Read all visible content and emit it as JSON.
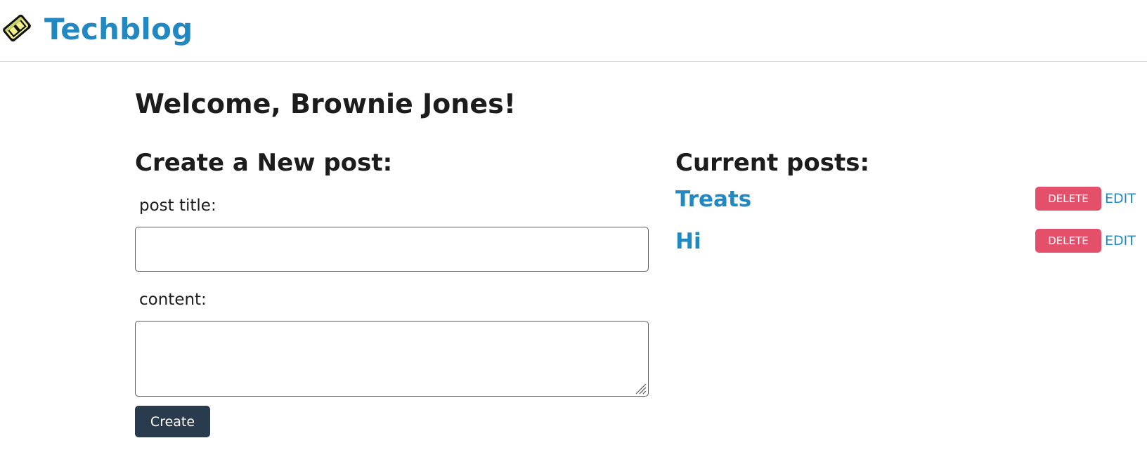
{
  "header": {
    "logo_icon": "cube-logo-icon",
    "brand": "Techblog"
  },
  "welcome": "Welcome, Brownie Jones!",
  "create": {
    "heading": "Create a New post:",
    "title_label": "post title:",
    "title_value": "",
    "content_label": "content:",
    "content_value": "",
    "button": "Create"
  },
  "current": {
    "heading": "Current posts:",
    "posts": [
      {
        "title": "Treats",
        "delete_label": "DELETE",
        "edit_label": "EDIT"
      },
      {
        "title": "Hi",
        "delete_label": "DELETE",
        "edit_label": "EDIT"
      }
    ]
  },
  "colors": {
    "brand": "#2288c2",
    "primary_button": "#2b3b4e",
    "danger_button": "#e4506a"
  }
}
